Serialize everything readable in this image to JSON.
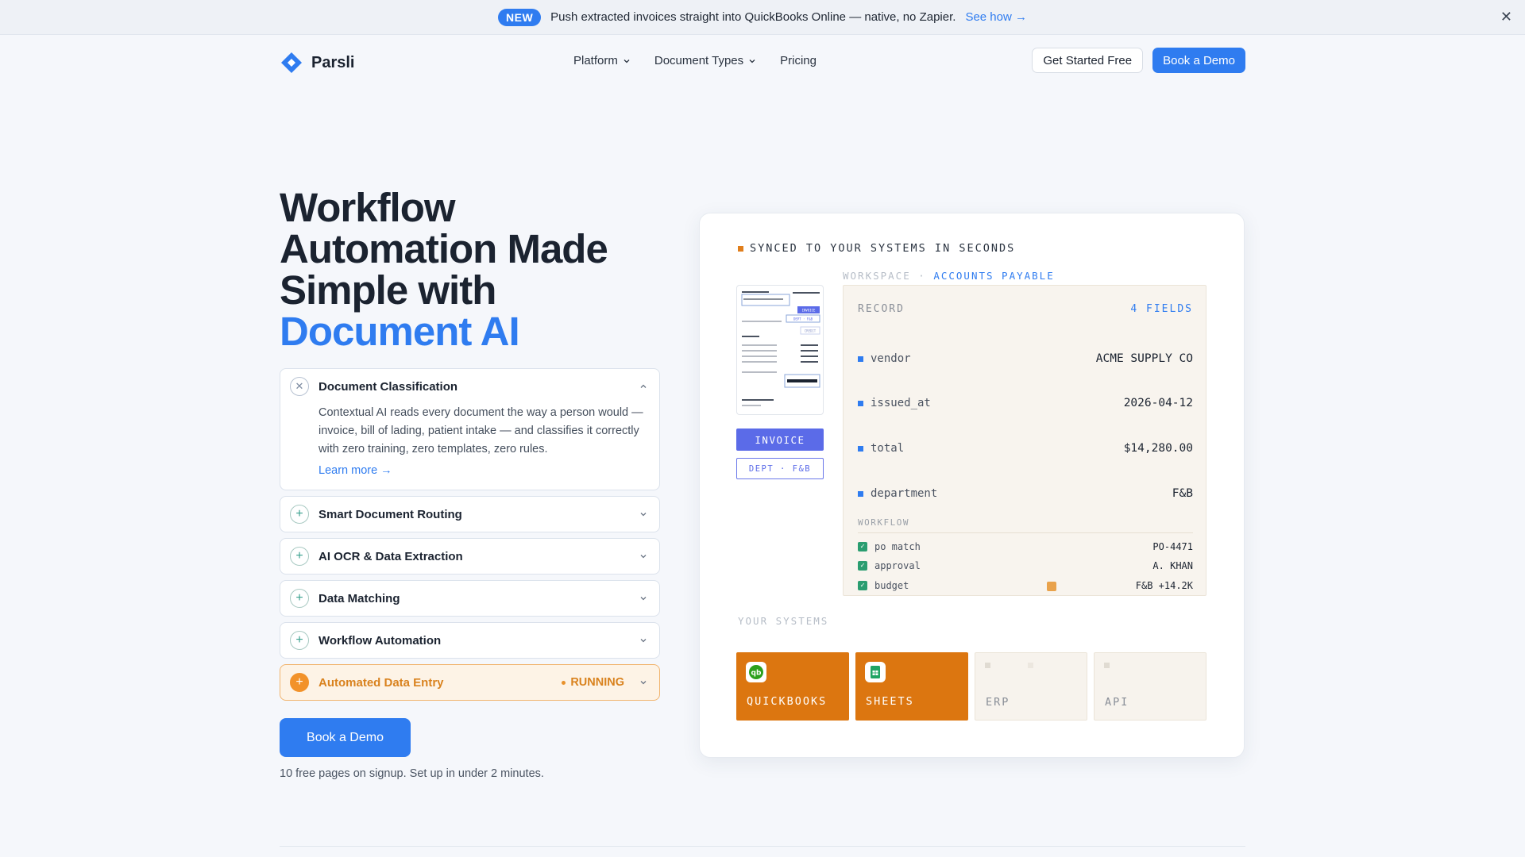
{
  "announcement": {
    "badge": "NEW",
    "text": "Push extracted invoices straight into QuickBooks Online — native, no Zapier.",
    "link": "See how →",
    "close": "✕"
  },
  "nav": {
    "brand": "Parsli",
    "links": [
      "Platform",
      "Document Types",
      "Pricing"
    ],
    "get_started": "Get Started Free",
    "book_demo": "Book a Demo"
  },
  "hero": {
    "title_line1": "Workflow Automation Made Simple with",
    "title_accent": "Document AI",
    "accordion": [
      {
        "title": "Document Classification",
        "body": "Contextual AI reads every document the way a person would — invoice, bill of lading, patient intake — and classifies it correctly with zero training, zero templates, zero rules.",
        "link": "Learn more →",
        "open": true
      },
      {
        "title": "Smart Document Routing"
      },
      {
        "title": "AI OCR & Data Extraction"
      },
      {
        "title": "Data Matching"
      },
      {
        "title": "Workflow Automation"
      },
      {
        "title": "Automated Data Entry",
        "status": "RUNNING"
      }
    ],
    "cta": "Book a Demo",
    "note": "10 free pages on signup. Set up in under 2 minutes."
  },
  "card": {
    "header": "SYNCED TO YOUR SYSTEMS IN SECONDS",
    "workspace_prefix": "WORKSPACE ·",
    "workspace_name": "ACCOUNTS PAYABLE",
    "doc_tag": "INVOICE",
    "doc_dept": "DEPT · F&B",
    "record_label": "RECORD",
    "record_count": "4 FIELDS",
    "fields": [
      {
        "key": "vendor",
        "value": "ACME SUPPLY CO"
      },
      {
        "key": "issued_at",
        "value": "2026-04-12"
      },
      {
        "key": "total",
        "value": "$14,280.00"
      },
      {
        "key": "department",
        "value": "F&B"
      }
    ],
    "workflow_label": "WORKFLOW",
    "workflow": [
      {
        "key": "po match",
        "value": "PO-4471"
      },
      {
        "key": "approval",
        "value": "A. KHAN"
      },
      {
        "key": "budget",
        "value": "F&B +14.2K"
      }
    ],
    "systems_label": "YOUR SYSTEMS",
    "systems": [
      "QUICKBOOKS",
      "SHEETS",
      "ERP",
      "API"
    ],
    "thumb_labels": [
      "INVOICE",
      "DEPT · F&B",
      "CREDIT"
    ]
  },
  "colors": {
    "accent": "#2f7cf0",
    "orange": "#dc7610",
    "indigo": "#5b6be8",
    "green": "#2a9d70"
  }
}
